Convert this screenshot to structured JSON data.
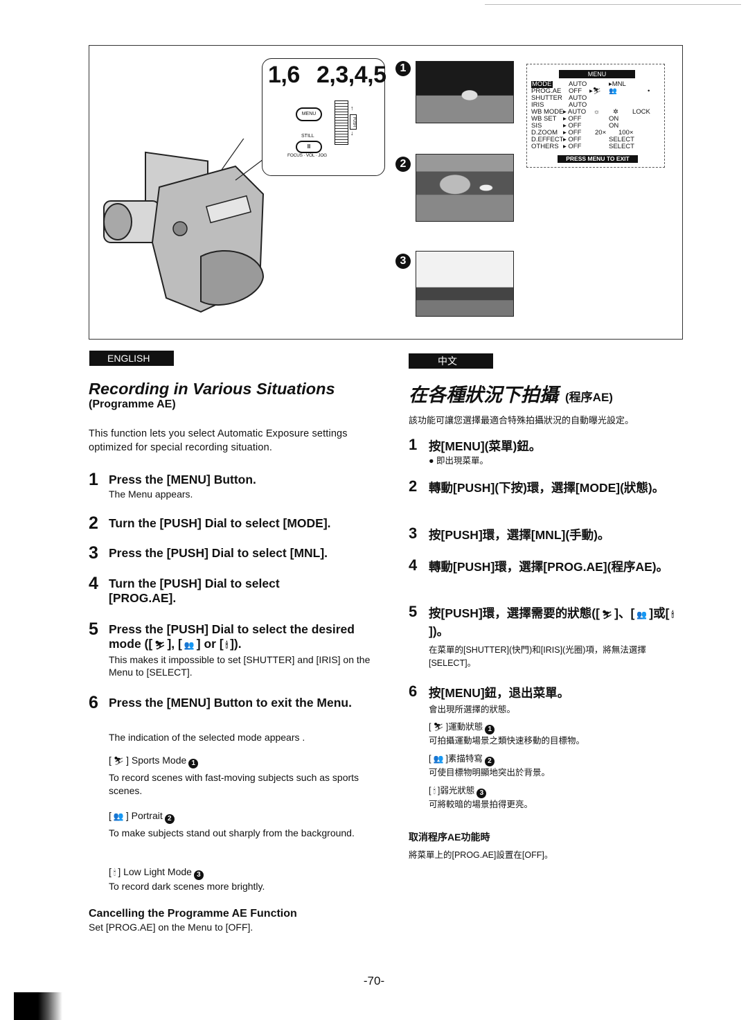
{
  "figure": {
    "callout": {
      "label_left": "1,6",
      "label_right": "2,3,4,5",
      "menu_button": "MENU",
      "still_label": "STILL",
      "still_button": "II",
      "dial_label": "FOCUS · VOL · JOG",
      "push_tag": "PUSH"
    },
    "photos": [
      {
        "number": "1",
        "subject": "sports"
      },
      {
        "number": "2",
        "subject": "portrait"
      },
      {
        "number": "3",
        "subject": "low light"
      }
    ],
    "osd_menu": {
      "title": "MENU",
      "rows": [
        {
          "item": "MODE",
          "values": [
            "AUTO",
            "",
            "▸MNL",
            "",
            ""
          ]
        },
        {
          "item": "PROG.AE",
          "values": [
            "OFF",
            "▸sports-icon",
            "portrait-icon",
            "lowlight-icon",
            ""
          ]
        },
        {
          "item": "SHUTTER",
          "values": [
            "AUTO",
            "",
            "",
            "",
            ""
          ]
        },
        {
          "item": "IRIS",
          "values": [
            "AUTO",
            "",
            "",
            "",
            ""
          ]
        },
        {
          "item": "WB MODE",
          "values": [
            "▸ AUTO",
            "outdoor-icon",
            "indoor-icon",
            "LOCK",
            ""
          ]
        },
        {
          "item": "WB SET",
          "values": [
            "▸ OFF",
            "",
            "ON",
            "",
            ""
          ]
        },
        {
          "item": "SIS",
          "values": [
            "▸ OFF",
            "",
            "ON",
            "",
            ""
          ]
        },
        {
          "item": "D.ZOOM",
          "values": [
            "▸ OFF",
            "20×",
            "100×",
            "",
            ""
          ]
        },
        {
          "item": "D.EFFECT",
          "values": [
            "▸ OFF",
            "",
            "SELECT",
            "",
            ""
          ]
        },
        {
          "item": "OTHERS",
          "values": [
            "▸ OFF",
            "",
            "SELECT",
            "",
            ""
          ]
        }
      ],
      "footer": "PRESS MENU TO EXIT"
    }
  },
  "english": {
    "tab": "ENGLISH",
    "title": "Recording in Various Situations",
    "subtitle": "(Programme AE)",
    "intro": "This function lets you select Automatic Exposure settings optimized for special recording situation.",
    "steps": [
      {
        "num": "1",
        "title": "Press the [MENU] Button.",
        "note": "The Menu appears."
      },
      {
        "num": "2",
        "title": "Turn the [PUSH] Dial to select [MODE].",
        "note": ""
      },
      {
        "num": "3",
        "title": "Press the [PUSH] Dial to select [MNL].",
        "note": ""
      },
      {
        "num": "4",
        "title": "Turn the [PUSH] Dial to select [PROG.AE].",
        "note": ""
      },
      {
        "num": "5",
        "title_a": "Press the [PUSH] Dial to select the desired mode ([",
        "title_b": "], [",
        "title_c": "] or [",
        "title_d": "]).",
        "note": "This makes it impossible to set [SHUTTER] and [IRIS] on the Menu to [SELECT]."
      },
      {
        "num": "6",
        "title": "Press the [MENU] Button to exit the Menu.",
        "note": "The indication of the selected mode appears ."
      }
    ],
    "modes": [
      {
        "icon": "sports-icon",
        "glyph": "🏃",
        "name": "Sports Mode",
        "ref": "1",
        "desc": "To record scenes with fast-moving subjects such as sports scenes."
      },
      {
        "icon": "portrait-icon",
        "glyph": "👥",
        "name": "Portrait",
        "ref": "2",
        "desc": "To make subjects stand out sharply from the background."
      },
      {
        "icon": "low-light-icon",
        "glyph": "🕯",
        "name": "Low Light Mode",
        "ref": "3",
        "desc": "To record dark scenes more brightly."
      }
    ],
    "cancel": {
      "heading": "Cancelling the Programme AE Function",
      "text": "Set [PROG.AE] on the Menu to [OFF]."
    }
  },
  "chinese": {
    "tab": "中文",
    "title": "在各種狀況下拍攝",
    "title_suffix": "(程序AE)",
    "intro": "該功能可讓您選擇最適合特殊拍攝狀況的自動曝光設定。",
    "steps": [
      {
        "num": "1",
        "title": "按[MENU](菜單)鈕。",
        "note": "● 即出現菜單。"
      },
      {
        "num": "2",
        "title": "轉動[PUSH](下按)環，選擇[MODE](狀態)。",
        "note": ""
      },
      {
        "num": "3",
        "title": "按[PUSH]環，選擇[MNL](手動)。",
        "note": ""
      },
      {
        "num": "4",
        "title": "轉動[PUSH]環，選擇[PROG.AE](程序AE)。",
        "note": ""
      },
      {
        "num": "5",
        "title_a": "按[PUSH]環，選擇需要的狀態([",
        "title_b": "]、[",
        "title_c": "]或[",
        "title_d": "])。",
        "note": "在菜單的[SHUTTER](快門)和[IRIS](光圈)項，將無法選擇[SELECT]。"
      },
      {
        "num": "6",
        "title": "按[MENU]鈕，退出菜單。",
        "note": "會出現所選擇的狀態。"
      }
    ],
    "modes": [
      {
        "icon": "sports-icon",
        "glyph": "🏃",
        "name": "運動狀態",
        "ref": "1",
        "desc": "可拍攝運動場景之類快速移動的目標物。"
      },
      {
        "icon": "portrait-icon",
        "glyph": "👥",
        "name": "素描特寫",
        "ref": "2",
        "desc": "可使目標物明顯地突出於背景。"
      },
      {
        "icon": "low-light-icon",
        "glyph": "🕯",
        "name": "弱光狀態",
        "ref": "3",
        "desc": "可將較暗的場景拍得更亮。"
      }
    ],
    "cancel": {
      "heading": "取消程序AE功能時",
      "text": "將菜單上的[PROG.AE]設置在[OFF]。"
    }
  },
  "page_number": "-70-"
}
